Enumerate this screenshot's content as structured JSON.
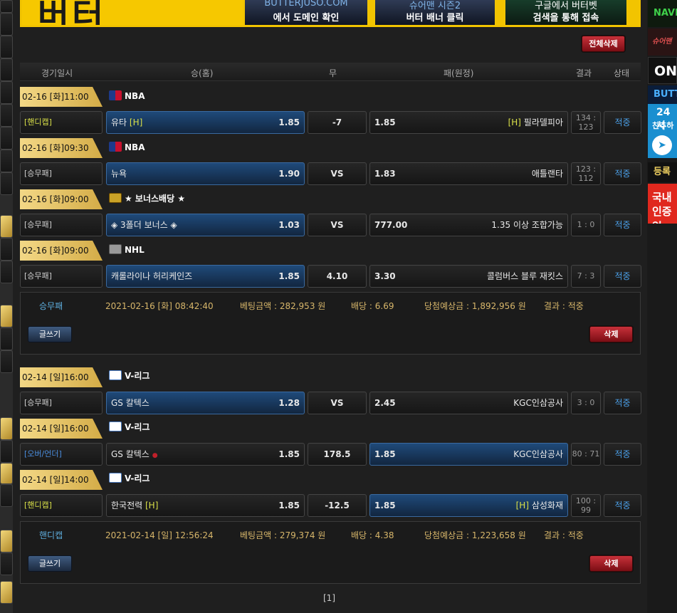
{
  "banner": {
    "logo_text": "버터",
    "promo1_line1": "BUTTERJUSO.COM",
    "promo1_line2": "에서 도메인 확인",
    "promo2_line1": "슈어맨 시즌2",
    "promo2_line2": "버터 배너 클릭",
    "promo3_line1": "구글에서 버터벳",
    "promo3_line2": "검색을 통해 접속"
  },
  "toolbar": {
    "delete_all_label": "전체삭제"
  },
  "table_header": {
    "date": "경기일시",
    "home": "승(홈)",
    "draw": "무",
    "away": "패(원정)",
    "result": "결과",
    "status": "상태"
  },
  "bets": [
    {
      "games": [
        {
          "date": "02-16 [화]11:00",
          "league": "NBA",
          "type": "[핸디캡]",
          "home": "유타",
          "home_mark": "[H]",
          "home_odd": "1.85",
          "draw": "-7",
          "away_odd": "1.85",
          "away_mark": "[H]",
          "away": "필라델피아",
          "result_line1": "134 :",
          "result_line2": "123",
          "status": "적중"
        },
        {
          "date": "02-16 [화]09:30",
          "league": "NBA",
          "type": "[승무패]",
          "home": "뉴욕",
          "home_mark": "",
          "home_odd": "1.90",
          "draw": "VS",
          "away_odd": "1.83",
          "away_mark": "",
          "away": "애틀랜타",
          "result_line1": "123 :",
          "result_line2": "112",
          "status": "적중"
        },
        {
          "date": "02-16 [화]09:00",
          "league": "★ 보너스배당 ★",
          "type": "[승무패]",
          "home": "◈ 3폴더 보너스 ◈",
          "home_mark": "",
          "home_odd": "1.03",
          "draw": "VS",
          "away_odd": "777.00",
          "away_mark": "",
          "away": "1.35 이상 조합가능",
          "result_line1": "1 : 0",
          "result_line2": "",
          "status": "적중"
        },
        {
          "date": "02-16 [화]09:00",
          "league": "NHL",
          "type": "[승무패]",
          "home": "캐롤라이나 허리케인즈",
          "home_mark": "",
          "home_odd": "1.85",
          "draw": "4.10",
          "away_odd": "3.30",
          "away_mark": "",
          "away": "콜럼버스 블루 재킷스",
          "result_line1": "7 : 3",
          "result_line2": "",
          "status": "적중"
        }
      ],
      "summary": {
        "kind": "승무패",
        "datetime": "2021-02-16 [화] 08:42:40",
        "bet_amount": "베팅금액 : 282,953 원",
        "odds": "배당 : 6.69",
        "expected": "당첨예상금 : 1,892,956 원",
        "result": "결과 : 적중",
        "write_label": "글쓰기",
        "delete_label": "삭제"
      }
    },
    {
      "games": [
        {
          "date": "02-14 [일]16:00",
          "league": "V-리그",
          "type": "[승무패]",
          "home": "GS 칼텍스",
          "home_mark": "",
          "home_odd": "1.28",
          "draw": "VS",
          "away_odd": "2.45",
          "away_mark": "",
          "away": "KGC인삼공사",
          "result_line1": "3 : 0",
          "result_line2": "",
          "status": "적중"
        },
        {
          "date": "02-14 [일]16:00",
          "league": "V-리그",
          "type": "[오버/언더]",
          "home": "GS 칼텍스",
          "home_mark": "",
          "home_odd": "1.85",
          "draw": "178.5",
          "away_odd": "1.85",
          "away_mark": "",
          "away": "KGC인삼공사",
          "result_line1": "80 : 71",
          "result_line2": "",
          "status": "적중"
        },
        {
          "date": "02-14 [일]14:00",
          "league": "V-리그",
          "type": "[핸디캡]",
          "home": "한국전력",
          "home_mark": "[H]",
          "home_odd": "1.85",
          "draw": "-12.5",
          "away_odd": "1.85",
          "away_mark": "[H]",
          "away": "삼성화재",
          "result_line1": "100 :",
          "result_line2": "99",
          "status": "적중"
        }
      ],
      "summary": {
        "kind": "핸디캡",
        "datetime": "2021-02-14 [일] 12:56:24",
        "bet_amount": "베팅금액 : 279,374 원",
        "odds": "배당 : 4.38",
        "expected": "당첨예상금 : 1,223,658 원",
        "result": "결과 : 적중",
        "write_label": "글쓰기",
        "delete_label": "삭제"
      }
    }
  ],
  "pagination": {
    "current": "[1]"
  },
  "right_banners": {
    "b1": "NAVE",
    "b2": "슈어맨",
    "b3": "ON",
    "b4": "BUTT",
    "b5_line1": "24시",
    "b5_line2": "친추하",
    "b6": "등록업",
    "b7_line1": "국내",
    "b7_line2": "인증업"
  },
  "colors": {
    "date_gold": "#e3c266",
    "status_blue": "#4a9ee6",
    "selected_blue": "#1f4a7a",
    "delete_red": "#b0202a",
    "summary_gold": "#d7b66a"
  }
}
